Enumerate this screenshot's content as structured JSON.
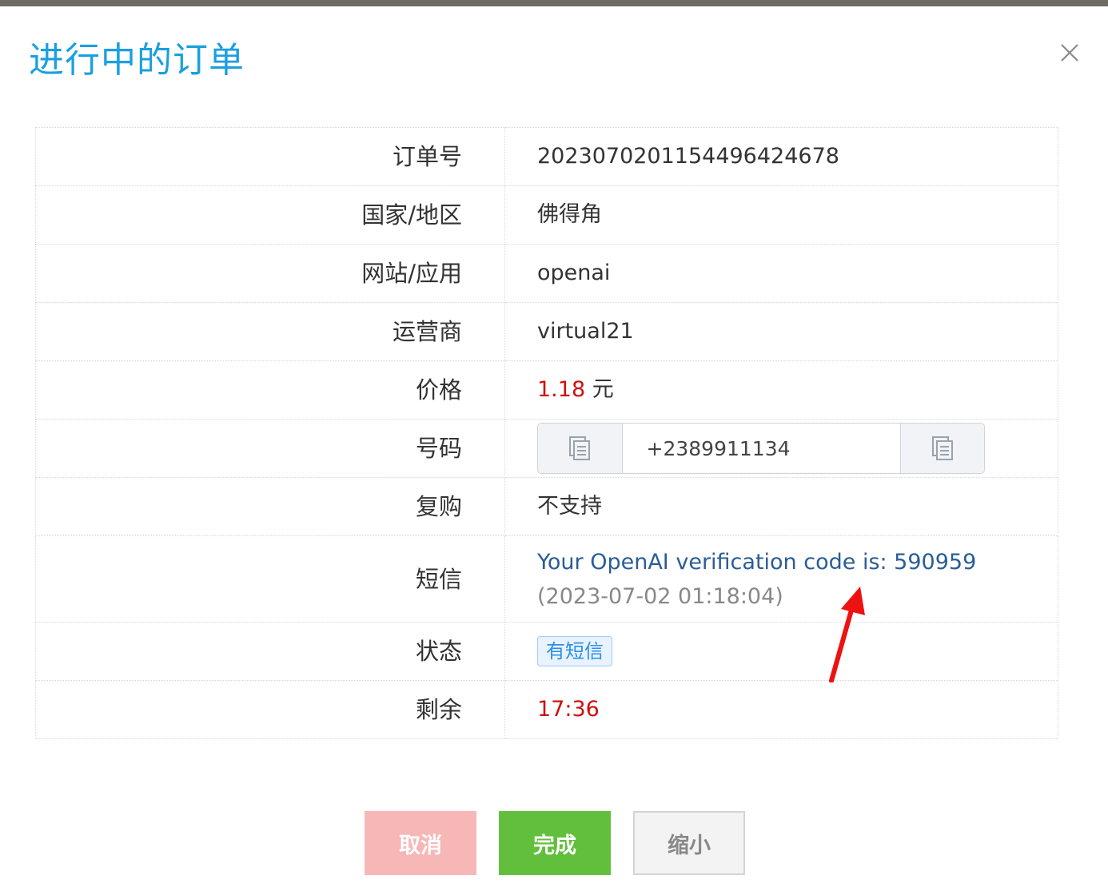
{
  "modal": {
    "title": "进行中的订单"
  },
  "order": {
    "order_no": {
      "label": "订单号",
      "value": "20230702011544964246​78"
    },
    "region": {
      "label": "国家/地区",
      "value": "佛得角"
    },
    "service": {
      "label": "网站/应用",
      "value": "openai"
    },
    "operator": {
      "label": "运营商",
      "value": "virtual21"
    },
    "price": {
      "label": "价格",
      "amount": "1.18",
      "unit": "元"
    },
    "phone": {
      "label": "号码",
      "value": "+2389911134"
    },
    "repurchase": {
      "label": "复购",
      "value": "不支持"
    },
    "sms": {
      "label": "短信",
      "text": "Your OpenAI verification code is: 590959",
      "time": "(2023-07-02 01:18:04)"
    },
    "status": {
      "label": "状态",
      "badge": "有短信"
    },
    "remaining": {
      "label": "剩余",
      "value": "17:36"
    }
  },
  "buttons": {
    "cancel": "取消",
    "done": "完成",
    "minimize": "缩小"
  },
  "icons": {
    "close": "close-icon",
    "copy": "copy-icon",
    "annotation": "red-arrow"
  },
  "colors": {
    "title": "#1a9fe0",
    "price": "#cc1111",
    "sms": "#2a5d96",
    "badge": "#2b8fe6",
    "cancel": "#f7b7b7",
    "done": "#62bf3c",
    "arrow": "#ee1111"
  }
}
